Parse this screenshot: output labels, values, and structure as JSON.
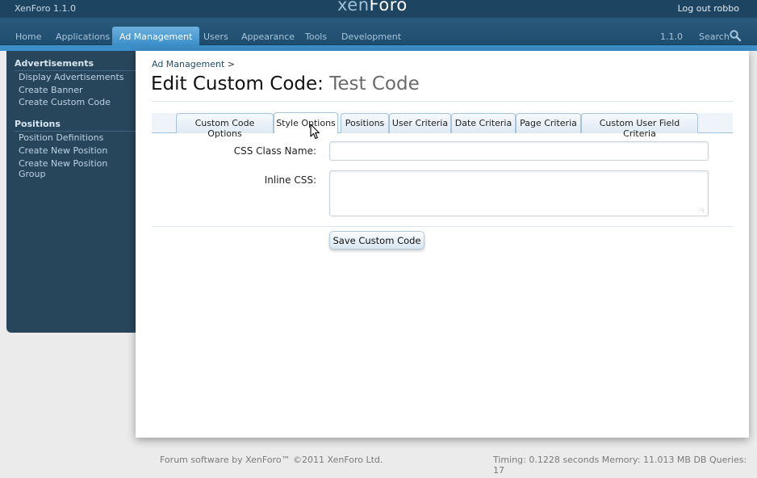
{
  "header": {
    "version_label": "XenForo 1.1.0",
    "logo_part1": "xen",
    "logo_part2": "Foro",
    "logout_label": "Log out robbo"
  },
  "nav": {
    "tabs": [
      {
        "label": "Home"
      },
      {
        "label": "Applications"
      },
      {
        "label": "Ad Management",
        "active": true
      },
      {
        "label": "Users"
      },
      {
        "label": "Appearance"
      },
      {
        "label": "Tools"
      },
      {
        "label": "Development"
      }
    ],
    "version": "1.1.0",
    "search_label": "Search"
  },
  "sidebar": {
    "sections": [
      {
        "heading": "Advertisements",
        "links": [
          "Display Advertisements",
          "Create Banner",
          "Create Custom Code"
        ]
      },
      {
        "heading": "Positions",
        "links": [
          "Position Definitions",
          "Create New Position",
          "Create New Position Group"
        ]
      }
    ]
  },
  "main": {
    "breadcrumb": "Ad Management",
    "breadcrumb_sep": ">",
    "title_prefix": "Edit Custom Code:",
    "title_subject": "Test Code",
    "tabs": [
      {
        "label": "Custom Code Options"
      },
      {
        "label": "Style Options",
        "active": true
      },
      {
        "label": "Positions"
      },
      {
        "label": "User Criteria"
      },
      {
        "label": "Date Criteria"
      },
      {
        "label": "Page Criteria"
      },
      {
        "label": "Custom User Field Criteria"
      }
    ],
    "form": {
      "css_class_label": "CSS Class Name:",
      "css_class_value": "",
      "inline_css_label": "Inline CSS:",
      "inline_css_value": "",
      "save_label": "Save Custom Code"
    }
  },
  "footer": {
    "left": "Forum software by XenForo™ ©2011 XenForo Ltd.",
    "right": "Timing: 0.1228 seconds Memory: 11.013 MB DB Queries: 17"
  },
  "colors": {
    "header_bg": "#1d4461",
    "nav_active": "#3d8fc9",
    "sidebar_bg": "#27465c"
  }
}
